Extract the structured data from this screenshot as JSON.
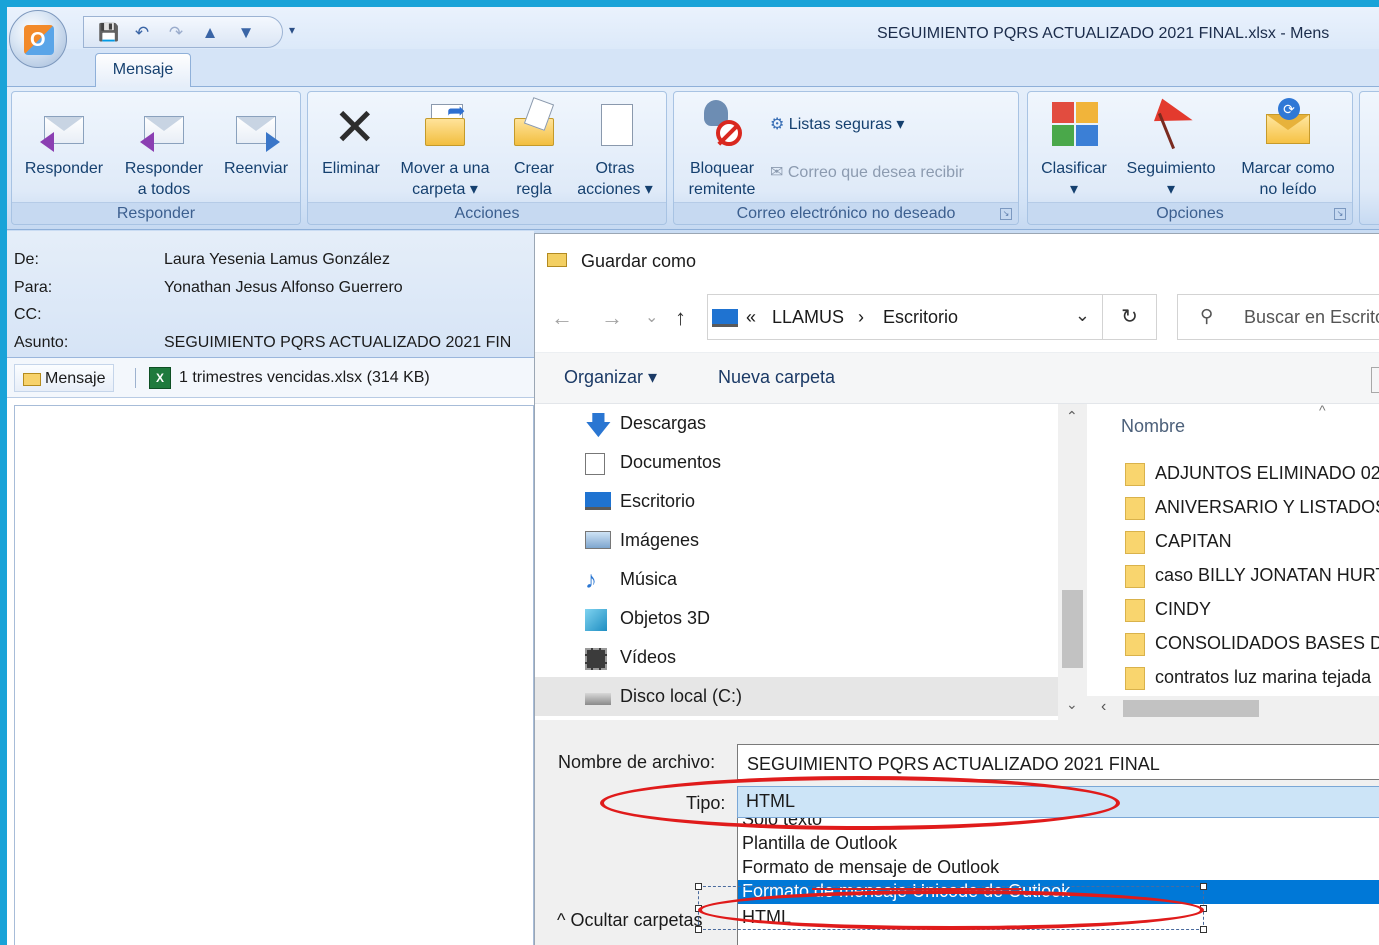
{
  "window": {
    "title": "SEGUIMIENTO PQRS ACTUALIZADO 2021 FINAL.xlsx - Mens",
    "accent": "#19a3d8"
  },
  "quick_access": {
    "icons": [
      "save-icon",
      "undo-icon",
      "redo-icon",
      "up-arrow-icon",
      "down-arrow-icon"
    ],
    "more": "▾"
  },
  "tabs": [
    {
      "label": "Mensaje",
      "active": true
    }
  ],
  "ribbon": {
    "groups": [
      {
        "label": "Responder",
        "buttons": [
          {
            "line1": "Responder",
            "line2": ""
          },
          {
            "line1": "Responder",
            "line2": "a todos"
          },
          {
            "line1": "Reenviar",
            "line2": ""
          }
        ]
      },
      {
        "label": "Acciones",
        "buttons": [
          {
            "line1": "Eliminar",
            "line2": ""
          },
          {
            "line1": "Mover a una",
            "line2": "carpeta ▾"
          },
          {
            "line1": "Crear",
            "line2": "regla"
          },
          {
            "line1": "Otras",
            "line2": "acciones ▾"
          }
        ]
      },
      {
        "label": "Correo electrónico no deseado",
        "buttons": [
          {
            "line1": "Bloquear",
            "line2": "remitente"
          }
        ],
        "small": [
          {
            "label": "Listas seguras ▾",
            "enabled": true
          },
          {
            "label": "Correo que desea recibir",
            "enabled": false
          }
        ]
      },
      {
        "label": "Opciones",
        "buttons": [
          {
            "line1": "Clasificar",
            "line2": "▾"
          },
          {
            "line1": "Seguimiento",
            "line2": "▾"
          },
          {
            "line1": "Marcar como",
            "line2": "no leído"
          }
        ]
      }
    ]
  },
  "message": {
    "labels": {
      "from": "De:",
      "to": "Para:",
      "cc": "CC:",
      "subject": "Asunto:"
    },
    "from": "Laura Yesenia Lamus González",
    "to": "Yonathan Jesus Alfonso Guerrero",
    "cc": "",
    "subject": "SEGUIMIENTO PQRS ACTUALIZADO 2021 FIN",
    "attachments": {
      "message_tab": "Mensaje",
      "file": "1 trimestres vencidas.xlsx (314 KB)"
    }
  },
  "dialog": {
    "title": "Guardar como",
    "nav_buttons": {
      "back": "←",
      "forward": "→",
      "recent": "⌄",
      "up": "↑"
    },
    "address": {
      "prefix": "«",
      "crumb1": "LLAMUS",
      "sep": "›",
      "crumb2": "Escritorio",
      "dropdown": "⌄"
    },
    "refresh": "↻",
    "search_placeholder": "Buscar en Escrito",
    "commands": {
      "organize": "Organizar ▾",
      "new_folder": "Nueva carpeta"
    },
    "nav_items": [
      {
        "label": "Descargas",
        "icon": "download-icon",
        "selected": false
      },
      {
        "label": "Documentos",
        "icon": "documents-icon",
        "selected": false
      },
      {
        "label": "Escritorio",
        "icon": "desktop-icon",
        "selected": false
      },
      {
        "label": "Imágenes",
        "icon": "pictures-icon",
        "selected": false
      },
      {
        "label": "Música",
        "icon": "music-icon",
        "selected": false
      },
      {
        "label": "Objetos 3D",
        "icon": "3d-objects-icon",
        "selected": false
      },
      {
        "label": "Vídeos",
        "icon": "videos-icon",
        "selected": false
      },
      {
        "label": "Disco local (C:)",
        "icon": "drive-icon",
        "selected": true
      }
    ],
    "file_list": {
      "column": "Nombre",
      "sort_indicator": "^",
      "items": [
        "ADJUNTOS ELIMINADO 02",
        "ANIVERSARIO Y LISTADOS",
        "CAPITAN",
        "caso BILLY JONATAN HURT",
        "CINDY",
        "CONSOLIDADOS BASES DE",
        "contratos luz marina tejada"
      ]
    },
    "filename_label": "Nombre de archivo:",
    "filename_value": "SEGUIMIENTO PQRS ACTUALIZADO 2021 FINAL",
    "type_label": "Tipo:",
    "type_value": "HTML",
    "type_options": [
      {
        "label": "Sólo texto",
        "highlighted": false
      },
      {
        "label": "Plantilla de Outlook",
        "highlighted": false
      },
      {
        "label": "Formato de mensaje de Outlook",
        "highlighted": false
      },
      {
        "label": "Formato de mensaje Unicode de Outlook",
        "highlighted": true
      },
      {
        "label": "HTML",
        "highlighted": false
      }
    ],
    "hide_folders": "^ Ocultar carpetas"
  },
  "annotation_color": "#e01b1b"
}
